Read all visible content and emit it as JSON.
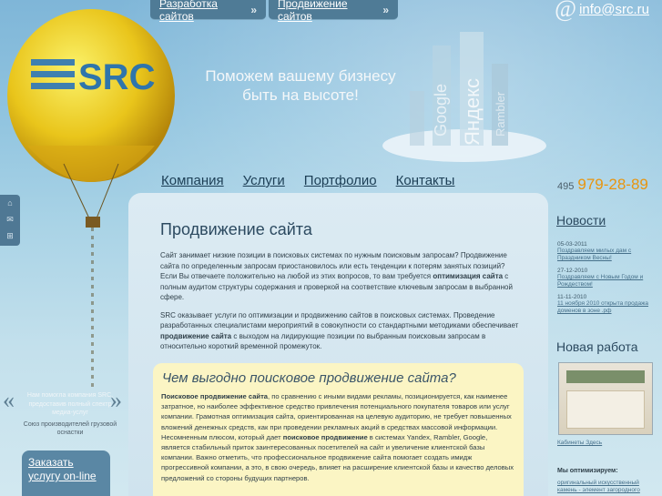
{
  "top_nav": [
    {
      "label": "Разработка сайтов",
      "arrow": "»"
    },
    {
      "label": "Продвижение сайтов",
      "arrow": "»"
    }
  ],
  "email": {
    "symbol": "@",
    "address": "info@src.ru"
  },
  "logo": {
    "text": "SRC"
  },
  "slogan": {
    "line1": "Поможем вашему бизнесу",
    "line2": "быть на высоте!"
  },
  "city_words": [
    "Google",
    "Яндекс",
    "Rambler"
  ],
  "main_nav": [
    "Компания",
    "Услуги",
    "Портфолио",
    "Контакты"
  ],
  "phone": {
    "code": "495",
    "number": "979-28-89"
  },
  "side_icons": [
    "home-icon",
    "sitemap-icon",
    "mail-icon"
  ],
  "page": {
    "title": "Продвижение сайта",
    "p1": "Сайт занимает низкие позиции в поисковых системах по нужным поисковым запросам? Продвижение сайта по определенным запросам приостановилось или есть тенденции к потерям занятых позиций? Если Вы отвечаете положительно на любой из этих вопросов, то вам требуется",
    "p1_bold": "оптимизация сайта",
    "p1_end": "с полным аудитом структуры содержания и проверкой на соответствие ключевым запросам в выбранной сфере.",
    "p2": "SRC оказывает услуги по оптимизации и продвижению сайтов в поисковых системах. Проведение разработанных специалистами мероприятий в совокупности со стандартными методиками обеспечивает",
    "p2_bold": "продвижение сайта",
    "p2_end": "с выходом на лидирующие позиции по выбранным поисковым запросам в относительно короткий временной промежуток."
  },
  "highlight": {
    "title": "Чем выгодно поисковое продвижение сайта?",
    "bold1": "Поисковое продвижение сайта",
    "text1": ", по сравнению с иными видами рекламы, позиционируется, как наименее затратное, но наиболее эффективное средство привлечения потенциального покупателя товаров или услуг компании. Грамотная оптимизация сайта, ориентированная на целевую аудиторию, не требует повышенных вложений денежных средств, как при проведении рекламных акций в средствах массовой информации. Несомненным плюсом, который дает",
    "bold2": "поисковое продвижение",
    "text2": "в системах Yandex, Rambler, Google, является стабильный приток заинтересованных посетителей на сайт и увеличение клиентской базы компании. Важно отметить, что профессиональное продвижение сайта помогает создать имидж прогрессивной компании, а это, в свою очередь, влияет на расширение клиентской базы и качество деловых предложений со стороны будущих партнеров."
  },
  "news": {
    "title": "Новости",
    "items": [
      {
        "date": "05-03-2011",
        "text": "Поздравляем милых дам с Праздником Весны!"
      },
      {
        "date": "27-12-2010",
        "text": "Поздравляем с Новым Годом и Рождеством!"
      },
      {
        "date": "11-11-2010",
        "text": "11 ноября 2010 открыта продажа доменов в зоне .рф"
      }
    ]
  },
  "new_work": {
    "title": "Новая работа",
    "caption": "Кабинеты Здесь"
  },
  "optim": {
    "title": "Мы оптимизируем:",
    "text": "оригинальный искусственный камень - элемент загородного"
  },
  "promo": {
    "quote_open": "«",
    "quote_close": "»",
    "text": "Нам помогла компания SRC, предоставив полный спектр медиа-услуг",
    "author": "Союз производителей грузовой оснастки"
  },
  "order": {
    "line1": "Заказать",
    "line2": "услугу on-line"
  },
  "colors": {
    "accent": "#e8950f",
    "nav_bg": "#4f7b96",
    "highlight_bg": "#fbf5c4"
  }
}
